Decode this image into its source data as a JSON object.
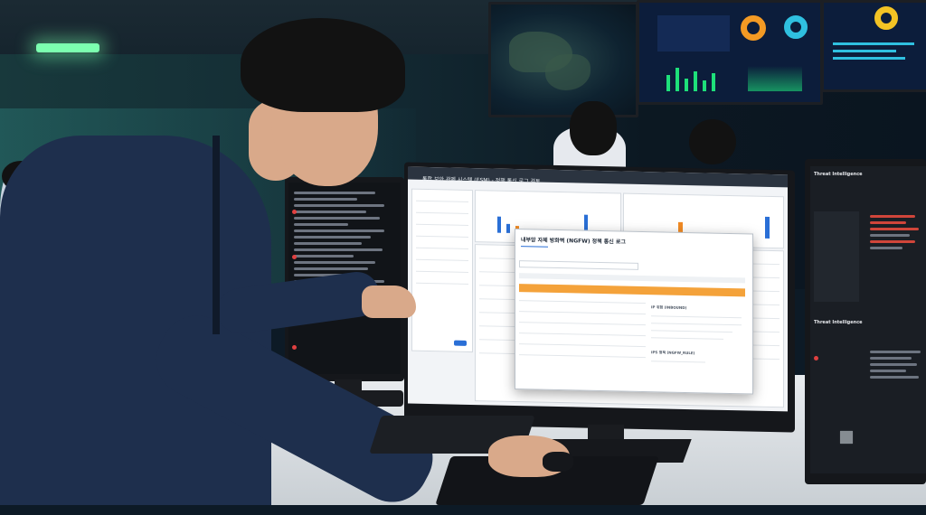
{
  "scene": {
    "description_domain": "natural-image"
  },
  "main_screen": {
    "title": "통합 보안 관제 시스템 (ESM) - 정책 통신 로그 검토",
    "modal_title": "내부망 자체 방화벽 (NGFW) 정책 통신 로그",
    "modal_section_1": "IP 위험 (INBOUND)",
    "modal_section_2": "IPS 정책 (NGFW_RULE)"
  },
  "right_screen": {
    "header": "Threat Intelligence",
    "section": "Threat Intelligence"
  },
  "colors": {
    "accent_orange": "#f4a23a",
    "wall_green": "#1ee07a",
    "shirt_navy": "#1e2f4d"
  }
}
